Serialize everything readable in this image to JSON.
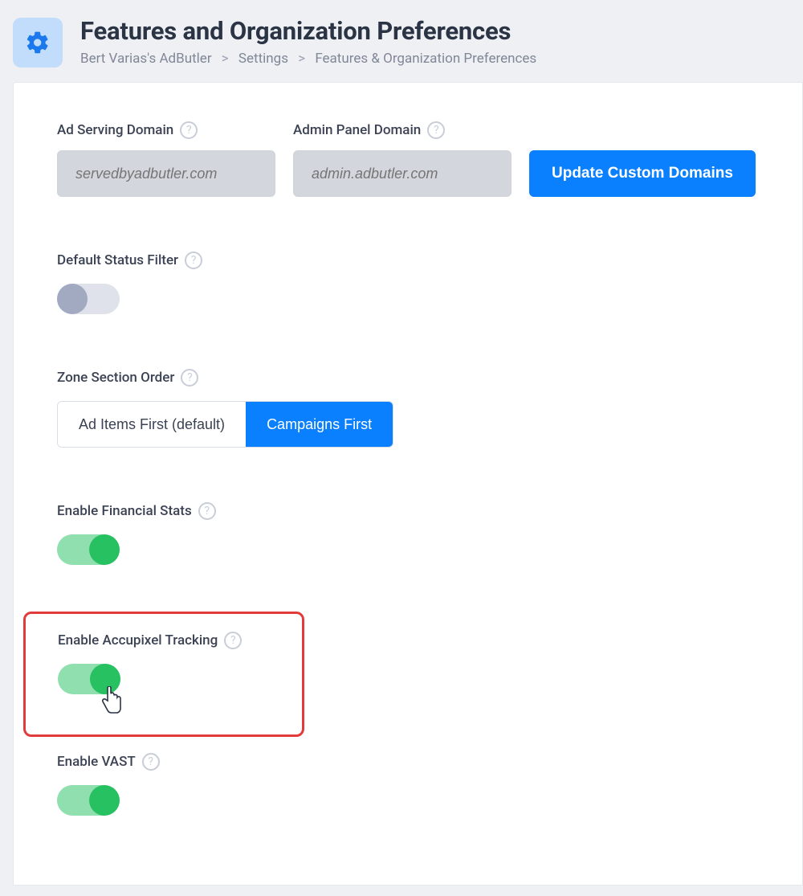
{
  "header": {
    "title": "Features and Organization Preferences",
    "breadcrumb": {
      "parts": [
        "Bert Varias's AdButler",
        "Settings",
        "Features & Organization Preferences"
      ],
      "sep": ">"
    }
  },
  "domains": {
    "ad_serving": {
      "label": "Ad Serving Domain",
      "placeholder": "servedbyadbutler.com"
    },
    "admin_panel": {
      "label": "Admin Panel Domain",
      "placeholder": "admin.adbutler.com"
    },
    "update_btn": "Update Custom Domains"
  },
  "default_status_filter": {
    "label": "Default Status Filter",
    "enabled": false
  },
  "zone_section_order": {
    "label": "Zone Section Order",
    "options": [
      "Ad Items First (default)",
      "Campaigns First"
    ],
    "active_index": 1
  },
  "financial_stats": {
    "label": "Enable Financial Stats",
    "enabled": true
  },
  "accupixel": {
    "label": "Enable Accupixel Tracking",
    "enabled": true
  },
  "vast": {
    "label": "Enable VAST",
    "enabled": true
  },
  "help_glyph": "?"
}
